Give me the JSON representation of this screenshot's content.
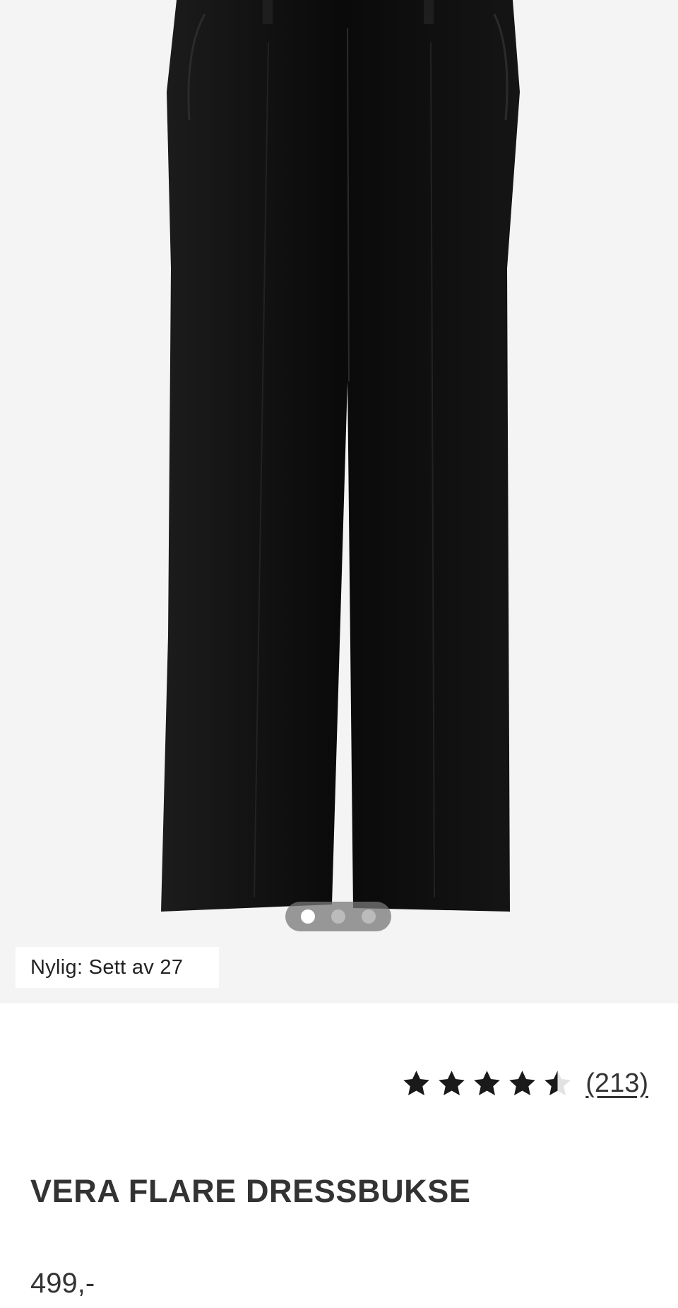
{
  "gallery": {
    "image": "black-flare-trousers-image",
    "slide_count": 3,
    "active_slide": 1
  },
  "recent_views_badge": "Nylig: Sett av 27",
  "rating": {
    "value": 4.5,
    "max": 5,
    "review_count": "(213)"
  },
  "product": {
    "title": "VERA FLARE DRESSBUKSE",
    "price": "499,-"
  },
  "colors": {
    "background": "#f4f4f4",
    "product_black": "#0b0b0b",
    "text": "#333333"
  }
}
